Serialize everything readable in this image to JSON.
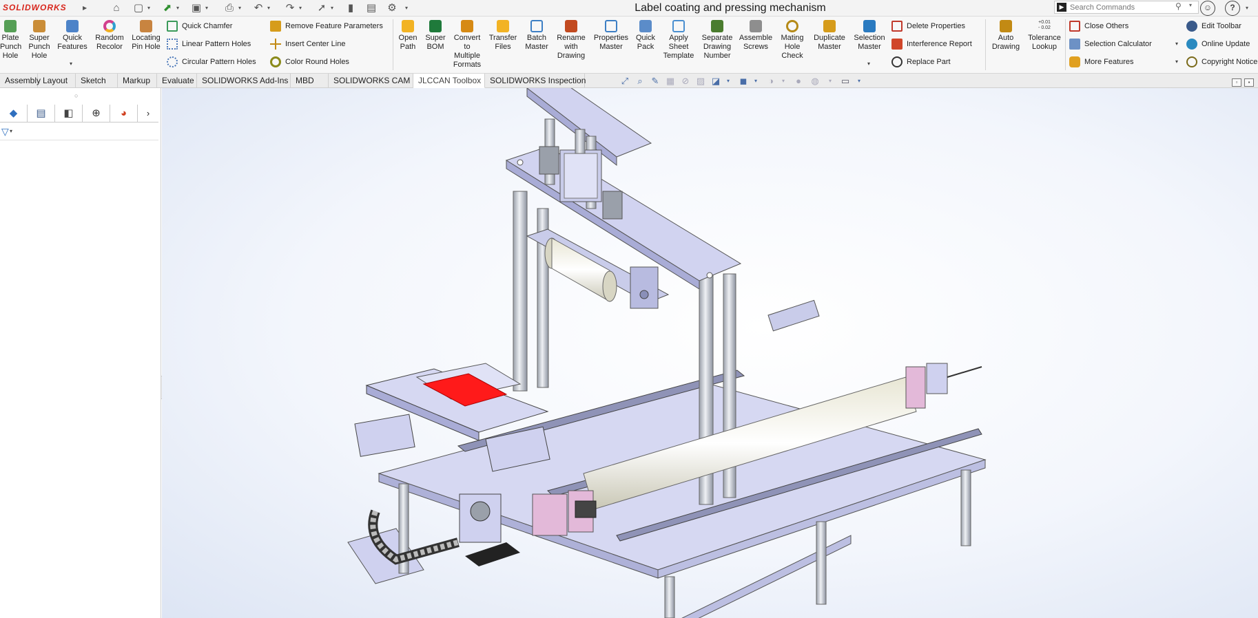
{
  "app": {
    "logo_text": "SOLIDWORKS",
    "document_title": "Label coating and pressing mechanism"
  },
  "search": {
    "placeholder": "Search Commands"
  },
  "ribbon": {
    "group1": [
      {
        "label": "Plate Punch Hole",
        "icon": "plate-punch-icon",
        "color": "#3a8f3a"
      },
      {
        "label": "Super Punch Hole",
        "icon": "super-punch-icon",
        "color": "#c27a16"
      },
      {
        "label": "Quick Features",
        "icon": "quick-features-icon",
        "color": "#2f6fbf"
      },
      {
        "label": "Random Recolor",
        "icon": "recolor-wheel-icon",
        "color": "#d23f8d"
      },
      {
        "label": "Locating Pin Hole",
        "icon": "pin-hole-icon",
        "color": "#c07020"
      }
    ],
    "group2": [
      {
        "label": "Quick Chamfer",
        "icon": "chamfer-icon",
        "color": "#3a9a5a"
      },
      {
        "label": "Linear Pattern Holes",
        "icon": "linear-pattern-icon",
        "color": "#4a77b8"
      },
      {
        "label": "Circular Pattern Holes",
        "icon": "circular-pattern-icon",
        "color": "#4a77b8"
      }
    ],
    "group3": [
      {
        "label": "Remove Feature Parameters",
        "icon": "remove-params-icon",
        "color": "#d69c1b"
      },
      {
        "label": "Insert Center Line",
        "icon": "center-line-icon",
        "color": "#c28a14"
      },
      {
        "label": "Color Round Holes",
        "icon": "round-holes-icon",
        "color": "#8a8a1a"
      }
    ],
    "group4": [
      {
        "label": "Open Path",
        "icon": "folder-icon",
        "color": "#f2b324"
      },
      {
        "label": "Super BOM",
        "icon": "excel-icon",
        "color": "#1f7a3b"
      },
      {
        "label": "Convert to Multiple Formats",
        "icon": "convert-icon",
        "color": "#d68a14"
      },
      {
        "label": "Transfer Files",
        "icon": "transfer-icon",
        "color": "#f2b324"
      },
      {
        "label": "Batch Master",
        "icon": "batch-icon",
        "color": "#3d7fc4"
      },
      {
        "label": "Rename with Drawing",
        "icon": "rename-icon",
        "color": "#c24a20"
      },
      {
        "label": "Properties Master",
        "icon": "properties-icon",
        "color": "#3d7fc4"
      },
      {
        "label": "Quick Pack",
        "icon": "pack-icon",
        "color": "#5b8cc9"
      },
      {
        "label": "Apply Sheet Template",
        "icon": "sheet-template-icon",
        "color": "#4a8fd0"
      },
      {
        "label": "Separate Drawing Number",
        "icon": "drawing-number-icon",
        "color": "#4a7c2e"
      },
      {
        "label": "Assemble Screws",
        "icon": "screws-icon",
        "color": "#8e8e8e"
      },
      {
        "label": "Mating Hole Check",
        "icon": "hole-check-icon",
        "color": "#b58a18"
      },
      {
        "label": "Duplicate Master",
        "icon": "duplicate-icon",
        "color": "#d69c1b"
      },
      {
        "label": "Selection Master",
        "icon": "selection-icon",
        "color": "#2a7ac0"
      }
    ],
    "group5": [
      {
        "label": "Delete Properties",
        "icon": "delete-properties-icon",
        "color": "#c0392b"
      },
      {
        "label": "Interference Report",
        "icon": "interference-icon",
        "color": "#d0462a"
      },
      {
        "label": "Replace Part",
        "icon": "replace-part-icon",
        "color": "#333333"
      }
    ],
    "group6": [
      {
        "label": "Auto Drawing",
        "icon": "auto-drawing-icon",
        "color": "#c28a14"
      },
      {
        "label": "Tolerance Lookup",
        "icon": "tolerance-icon",
        "color": "#555555",
        "badge_top": "+0.01",
        "badge_bottom": "- 0.02"
      }
    ],
    "group7": [
      {
        "label": "Close Others",
        "icon": "close-others-icon",
        "color": "#c0392b"
      },
      {
        "label": "Selection Calculator",
        "icon": "calculator-icon",
        "color": "#4a77b8"
      },
      {
        "label": "More Features",
        "icon": "thumbs-up-icon",
        "color": "#e0a020"
      }
    ],
    "group8": [
      {
        "label": "Edit Toolbar",
        "icon": "edit-toolbar-icon",
        "color": "#3a5a8a"
      },
      {
        "label": "Online Update",
        "icon": "globe-icon",
        "color": "#2a8ac0"
      },
      {
        "label": "Copyright Notice",
        "icon": "copyright-icon",
        "color": "#7a6a1a"
      }
    ]
  },
  "tabs": [
    {
      "label": "Assembly"
    },
    {
      "label": "Layout"
    },
    {
      "label": "Sketch"
    },
    {
      "label": "Markup"
    },
    {
      "label": "Evaluate"
    },
    {
      "label": "SOLIDWORKS Add-Ins"
    },
    {
      "label": "MBD"
    },
    {
      "label": "SOLIDWORKS CAM"
    },
    {
      "label": "JLCCAN Toolbox",
      "active": true
    },
    {
      "label": "SOLIDWORKS Inspection"
    }
  ],
  "left_panel": {
    "tabs": [
      "feature-manager-icon",
      "property-manager-icon",
      "configuration-icon",
      "dimxpert-icon",
      "display-manager-icon"
    ]
  },
  "graphics": {
    "highlight_color": "#ff1a1a",
    "frame_color": "#c7c9ee",
    "rod_color": "#c0c4cc"
  }
}
